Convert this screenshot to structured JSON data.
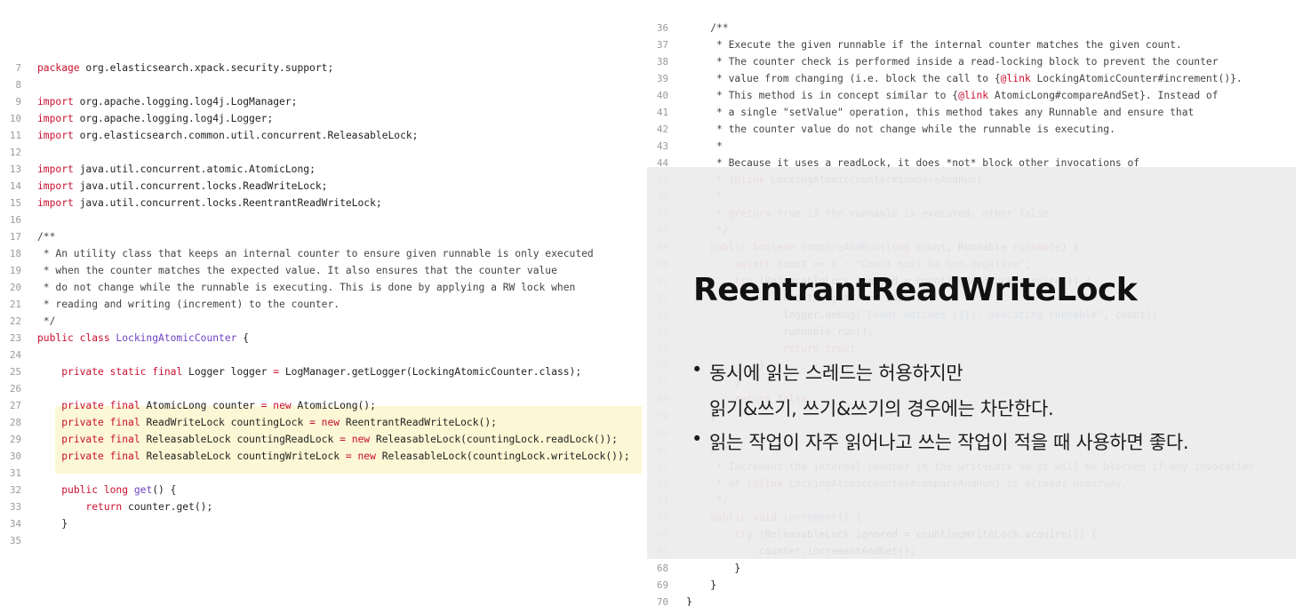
{
  "left_code": [
    {
      "n": "7",
      "s": [
        [
          "kw",
          "package"
        ],
        [
          "p",
          " org.elasticsearch.xpack.security.support;"
        ]
      ]
    },
    {
      "n": "8",
      "s": []
    },
    {
      "n": "9",
      "s": [
        [
          "kw",
          "import"
        ],
        [
          "p",
          " org.apache.logging.log4j.LogManager;"
        ]
      ]
    },
    {
      "n": "10",
      "s": [
        [
          "kw",
          "import"
        ],
        [
          "p",
          " org.apache.logging.log4j.Logger;"
        ]
      ]
    },
    {
      "n": "11",
      "s": [
        [
          "kw",
          "import"
        ],
        [
          "p",
          " org.elasticsearch.common.util.concurrent.ReleasableLock;"
        ]
      ]
    },
    {
      "n": "12",
      "s": []
    },
    {
      "n": "13",
      "s": [
        [
          "kw",
          "import"
        ],
        [
          "p",
          " java.util.concurrent.atomic.AtomicLong;"
        ]
      ]
    },
    {
      "n": "14",
      "s": [
        [
          "kw",
          "import"
        ],
        [
          "p",
          " java.util.concurrent.locks.ReadWriteLock;"
        ]
      ]
    },
    {
      "n": "15",
      "s": [
        [
          "kw",
          "import"
        ],
        [
          "p",
          " java.util.concurrent.locks.ReentrantReadWriteLock;"
        ]
      ]
    },
    {
      "n": "16",
      "s": []
    },
    {
      "n": "17",
      "s": [
        [
          "cm",
          "/**"
        ]
      ]
    },
    {
      "n": "18",
      "s": [
        [
          "cm",
          " * An utility class that keeps an internal counter to ensure given runnable is only executed"
        ]
      ]
    },
    {
      "n": "19",
      "s": [
        [
          "cm",
          " * when the counter matches the expected value. It also ensures that the counter value"
        ]
      ]
    },
    {
      "n": "20",
      "s": [
        [
          "cm",
          " * do not change while the runnable is executing. This is done by applying a RW lock when"
        ]
      ]
    },
    {
      "n": "21",
      "s": [
        [
          "cm",
          " * reading and writing (increment) to the counter."
        ]
      ]
    },
    {
      "n": "22",
      "s": [
        [
          "cm",
          " */"
        ]
      ]
    },
    {
      "n": "23",
      "s": [
        [
          "kw",
          "public class "
        ],
        [
          "cls",
          "LockingAtomicCounter"
        ],
        [
          "p",
          " {"
        ]
      ]
    },
    {
      "n": "24",
      "s": []
    },
    {
      "n": "25",
      "s": [
        [
          "p",
          "    "
        ],
        [
          "kw",
          "private static final "
        ],
        [
          "p",
          "Logger logger "
        ],
        [
          "kw",
          "="
        ],
        [
          "p",
          " LogManager.getLogger(LockingAtomicCounter.class);"
        ]
      ]
    },
    {
      "n": "26",
      "s": []
    },
    {
      "n": "27",
      "s": [
        [
          "p",
          "    "
        ],
        [
          "kw",
          "private final "
        ],
        [
          "p",
          "AtomicLong counter "
        ],
        [
          "kw",
          "= new "
        ],
        [
          "p",
          "AtomicLong();"
        ]
      ]
    },
    {
      "n": "28",
      "s": [
        [
          "p",
          "    "
        ],
        [
          "kw",
          "private final "
        ],
        [
          "p",
          "ReadWriteLock countingLock "
        ],
        [
          "kw",
          "= new "
        ],
        [
          "p",
          "ReentrantReadWriteLock();"
        ]
      ]
    },
    {
      "n": "29",
      "s": [
        [
          "p",
          "    "
        ],
        [
          "kw",
          "private final "
        ],
        [
          "p",
          "ReleasableLock countingReadLock "
        ],
        [
          "kw",
          "= new "
        ],
        [
          "p",
          "ReleasableLock(countingLock.readLock());"
        ]
      ]
    },
    {
      "n": "30",
      "s": [
        [
          "p",
          "    "
        ],
        [
          "kw",
          "private final "
        ],
        [
          "p",
          "ReleasableLock countingWriteLock "
        ],
        [
          "kw",
          "= new "
        ],
        [
          "p",
          "ReleasableLock(countingLock.writeLock());"
        ]
      ]
    },
    {
      "n": "31",
      "s": []
    },
    {
      "n": "32",
      "s": [
        [
          "p",
          "    "
        ],
        [
          "kw",
          "public long "
        ],
        [
          "cls",
          "get"
        ],
        [
          "p",
          "() {"
        ]
      ]
    },
    {
      "n": "33",
      "s": [
        [
          "p",
          "        "
        ],
        [
          "kw",
          "return "
        ],
        [
          "p",
          "counter.get();"
        ]
      ]
    },
    {
      "n": "34",
      "s": [
        [
          "p",
          "    }"
        ]
      ]
    },
    {
      "n": "35",
      "s": []
    }
  ],
  "right_code": [
    {
      "n": "36",
      "s": [
        [
          "cm",
          "    /**"
        ]
      ]
    },
    {
      "n": "37",
      "s": [
        [
          "cm",
          "     * Execute the given runnable if the internal counter matches the given count."
        ]
      ]
    },
    {
      "n": "38",
      "s": [
        [
          "cm",
          "     * The counter check is performed inside a read-locking block to prevent the counter"
        ]
      ]
    },
    {
      "n": "39",
      "s": [
        [
          "cm",
          "     * value from changing (i.e. block the call to {"
        ],
        [
          "at",
          "@link"
        ],
        [
          "cm",
          " LockingAtomicCounter#increment()}."
        ]
      ]
    },
    {
      "n": "40",
      "s": [
        [
          "cm",
          "     * This method is in concept similar to {"
        ],
        [
          "at",
          "@link"
        ],
        [
          "cm",
          " AtomicLong#compareAndSet}. Instead of"
        ]
      ]
    },
    {
      "n": "41",
      "s": [
        [
          "cm",
          "     * a single \"setValue\" operation, this method takes any Runnable and ensure that"
        ]
      ]
    },
    {
      "n": "42",
      "s": [
        [
          "cm",
          "     * the counter value do not change while the runnable is executing."
        ]
      ]
    },
    {
      "n": "43",
      "s": [
        [
          "cm",
          "     *"
        ]
      ]
    },
    {
      "n": "44",
      "s": [
        [
          "cm",
          "     * Because it uses a readLock, it does *not* block other invocations of"
        ]
      ]
    },
    {
      "n": "45",
      "s": [
        [
          "cm",
          "     * {"
        ],
        [
          "at",
          "@link"
        ],
        [
          "cm",
          " LockingAtomicCounter#compareAndRun}."
        ]
      ]
    },
    {
      "n": "46",
      "s": [
        [
          "cm",
          "     *"
        ]
      ]
    },
    {
      "n": "47",
      "s": [
        [
          "cm",
          "     * "
        ],
        [
          "at",
          "@return"
        ],
        [
          "cm",
          " true if the runnable is executed, other false."
        ]
      ]
    },
    {
      "n": "48",
      "s": [
        [
          "cm",
          "     */"
        ]
      ]
    },
    {
      "n": "49",
      "s": [
        [
          "p",
          "    "
        ],
        [
          "kw",
          "public boolean "
        ],
        [
          "cls",
          "compareAndRun"
        ],
        [
          "p",
          "("
        ],
        [
          "kw",
          "long "
        ],
        [
          "p",
          "count, Runnable "
        ],
        [
          "kw",
          "runnable"
        ],
        [
          "p",
          ") {"
        ]
      ]
    },
    {
      "n": "50",
      "s": [
        [
          "p",
          "        "
        ],
        [
          "kw",
          "assert "
        ],
        [
          "p",
          "count "
        ],
        [
          "kw",
          ">="
        ],
        [
          "num",
          " 0"
        ],
        [
          "p",
          " : "
        ],
        [
          "str",
          "\"Count must be non-negative\""
        ],
        [
          "p",
          ";"
        ]
      ]
    },
    {
      "n": "51",
      "s": [
        [
          "p",
          "        "
        ],
        [
          "kw",
          "try "
        ],
        [
          "p",
          "(ReleasableLock ignored = countingReadLock.acquire()) {"
        ]
      ]
    },
    {
      "n": "52",
      "s": [
        [
          "p",
          "            "
        ],
        [
          "kw",
          "if "
        ],
        [
          "p",
          "(counter.get() == count) {"
        ]
      ]
    },
    {
      "n": "53",
      "s": [
        [
          "p",
          "                logger.debug("
        ],
        [
          "str",
          "\"Count matches [{}], executing runnable\""
        ],
        [
          "p",
          ", count);"
        ]
      ]
    },
    {
      "n": "54",
      "s": [
        [
          "p",
          "                runnable.run();"
        ]
      ]
    },
    {
      "n": "55",
      "s": [
        [
          "p",
          "                "
        ],
        [
          "kw",
          "return true"
        ],
        [
          "p",
          ";"
        ]
      ]
    },
    {
      "n": "56",
      "s": [
        [
          "p",
          "            }"
        ]
      ]
    },
    {
      "n": "57",
      "s": [
        [
          "p",
          "        }"
        ]
      ]
    },
    {
      "n": "58",
      "s": [
        [
          "p",
          "        "
        ],
        [
          "kw",
          "return false"
        ],
        [
          "p",
          ";"
        ]
      ]
    },
    {
      "n": "59",
      "s": [
        [
          "p",
          "    }"
        ]
      ]
    },
    {
      "n": "60",
      "s": []
    },
    {
      "n": "61",
      "s": [
        [
          "cm",
          "    /**"
        ]
      ]
    },
    {
      "n": "62",
      "s": [
        [
          "cm",
          "     * Increment the internal counter in the writeLock so it will be blocked if any invocation"
        ]
      ]
    },
    {
      "n": "63",
      "s": [
        [
          "cm",
          "     * of {"
        ],
        [
          "at",
          "@link"
        ],
        [
          "cm",
          " LockingAtomicCounter#compareAndRun} is already underway."
        ]
      ]
    },
    {
      "n": "64",
      "s": [
        [
          "cm",
          "     */"
        ]
      ]
    },
    {
      "n": "65",
      "s": [
        [
          "p",
          "    "
        ],
        [
          "kw",
          "public void "
        ],
        [
          "cls",
          "increment"
        ],
        [
          "p",
          "() {"
        ]
      ]
    },
    {
      "n": "66",
      "s": [
        [
          "p",
          "        "
        ],
        [
          "kw",
          "try "
        ],
        [
          "p",
          "(ReleasableLock ignored = countingWriteLock.acquire()) {"
        ]
      ]
    },
    {
      "n": "67",
      "s": [
        [
          "p",
          "            counter.incrementAndGet();"
        ]
      ]
    },
    {
      "n": "68",
      "s": [
        [
          "p",
          "        }"
        ]
      ]
    },
    {
      "n": "69",
      "s": [
        [
          "p",
          "    }"
        ]
      ]
    },
    {
      "n": "70",
      "s": [
        [
          "p",
          "}"
        ]
      ]
    }
  ],
  "overlay": {
    "title": "ReentrantReadWriteLock",
    "bullet_symbol": "•",
    "bullets": [
      {
        "lines": [
          "동시에 읽는 스레드는 허용하지만",
          "읽기&쓰기, 쓰기&쓰기의 경우에는 차단한다."
        ]
      },
      {
        "lines": [
          "읽는 작업이 자주 읽어나고 쓰는 작업이 적을 때 사용하면 좋다."
        ]
      }
    ]
  },
  "colors": {
    "keyword": "#c8102e",
    "class_name": "#6f42c1",
    "string": "#1a5fb4",
    "highlight": "#fcf7d4",
    "overlay": "#ececec"
  }
}
